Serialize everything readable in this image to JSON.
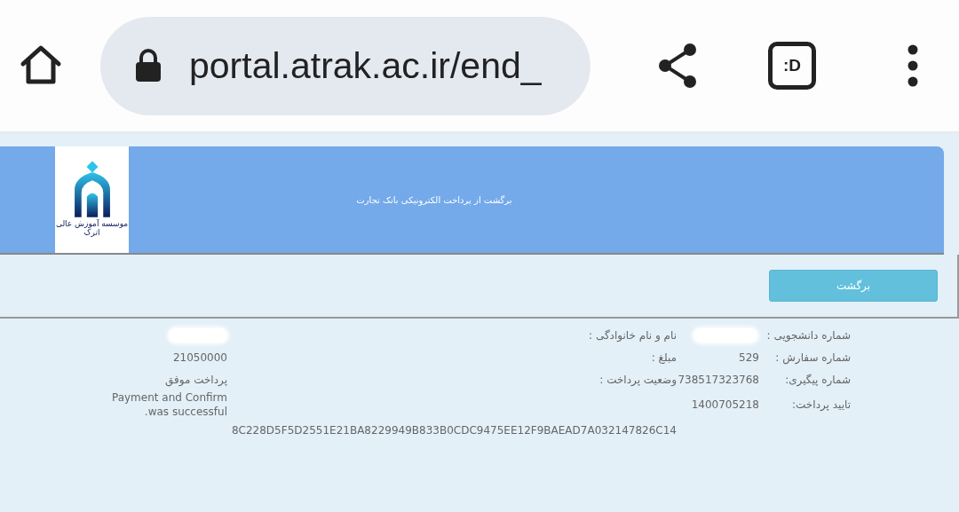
{
  "browser": {
    "url": "portal.atrak.ac.ir/end_",
    "tab_switcher": ":D"
  },
  "header": {
    "logo_text": "موسسه آموزش عالی اترک",
    "title": "برگشت از پرداخت الکترونیکی بانک تجارت"
  },
  "back_button": "برگشت",
  "rows": [
    {
      "label": "شماره دانشجویی :",
      "value_redacted": true,
      "label2": "نام و نام خانوادگی :",
      "value2_redacted": true
    },
    {
      "label": "شماره سفارش :",
      "value": "529",
      "label2": "مبلغ :",
      "value2": "21050000"
    },
    {
      "label": "شماره پیگیری:",
      "value": "738517323768",
      "label2": "وضعیت پرداخت :",
      "value2": "پرداخت موفق"
    },
    {
      "label": "تایید پرداخت:",
      "value": "1400705218",
      "value2": "Payment and Confirm was successful."
    }
  ],
  "hash": "8C228D5F5D2551E21BA8229949B833B0CDC9475EE12F9BAEAD7A032147826C14"
}
